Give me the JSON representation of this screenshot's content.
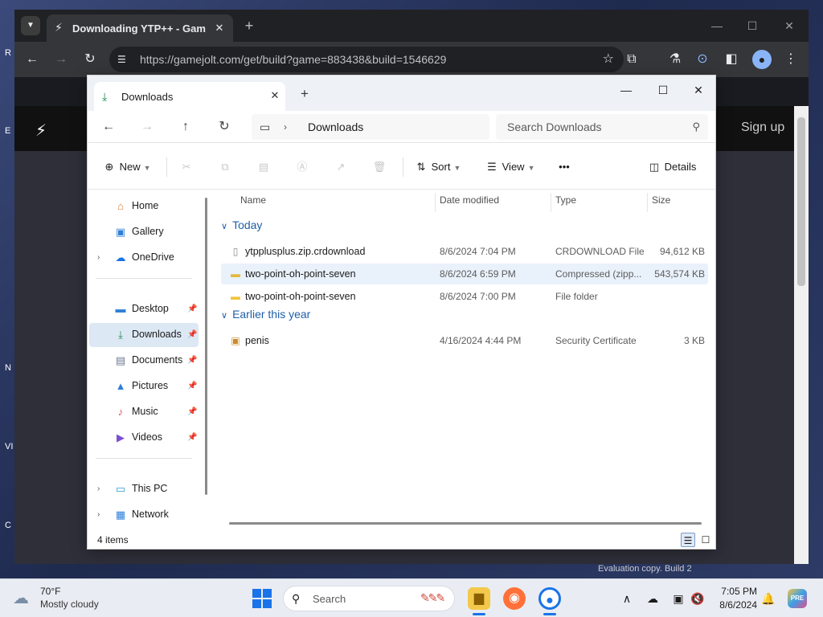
{
  "desktop": {
    "frag1": "R",
    "frag2": "E",
    "frag3": "N",
    "frag4": "VI",
    "frag5": "C",
    "watermark": "Evaluation copy. Build 2"
  },
  "chrome": {
    "tab_title": "Downloading YTP++ - Game Jolt",
    "url": "https://gamejolt.com/get/build?game=883438&build=1546629",
    "page_signup": "Sign up"
  },
  "explorer": {
    "tab_title": "Downloads",
    "address": "Downloads",
    "search_placeholder": "Search Downloads",
    "toolbar": {
      "new_label": "New",
      "sort_label": "Sort",
      "view_label": "View",
      "details_label": "Details"
    },
    "columns": {
      "name": "Name",
      "date": "Date modified",
      "type": "Type",
      "size": "Size"
    },
    "sidebar": [
      {
        "label": "Home",
        "icon": "home-icon"
      },
      {
        "label": "Gallery",
        "icon": "gallery-icon"
      },
      {
        "label": "OneDrive",
        "icon": "cloud-icon"
      },
      {
        "label": "Desktop",
        "icon": "desktop-icon"
      },
      {
        "label": "Downloads",
        "icon": "download-icon"
      },
      {
        "label": "Documents",
        "icon": "document-icon"
      },
      {
        "label": "Pictures",
        "icon": "pictures-icon"
      },
      {
        "label": "Music",
        "icon": "music-icon"
      },
      {
        "label": "Videos",
        "icon": "videos-icon"
      },
      {
        "label": "This PC",
        "icon": "computer-icon"
      },
      {
        "label": "Network",
        "icon": "network-icon"
      }
    ],
    "groups": [
      {
        "label": "Today",
        "files": [
          {
            "name": "ytpplusplus.zip.crdownload",
            "date": "8/6/2024 7:04 PM",
            "type": "CRDOWNLOAD File",
            "size": "94,612 KB"
          },
          {
            "name": "two-point-oh-point-seven",
            "date": "8/6/2024 6:59 PM",
            "type": "Compressed (zipp...",
            "size": "543,574 KB"
          },
          {
            "name": "two-point-oh-point-seven",
            "date": "8/6/2024 7:00 PM",
            "type": "File folder",
            "size": ""
          }
        ]
      },
      {
        "label": "Earlier this year",
        "files": [
          {
            "name": "penis",
            "date": "4/16/2024 4:44 PM",
            "type": "Security Certificate",
            "size": "3 KB"
          }
        ]
      }
    ],
    "status": "4 items"
  },
  "taskbar": {
    "temp": "70°F",
    "condition": "Mostly cloudy",
    "search_label": "Search",
    "time": "7:05 PM",
    "date": "8/6/2024",
    "badge": "PRE"
  },
  "colors": {
    "accent": "#1a73e8",
    "selection": "#dde8f5",
    "group_header": "#1f5fa8"
  }
}
